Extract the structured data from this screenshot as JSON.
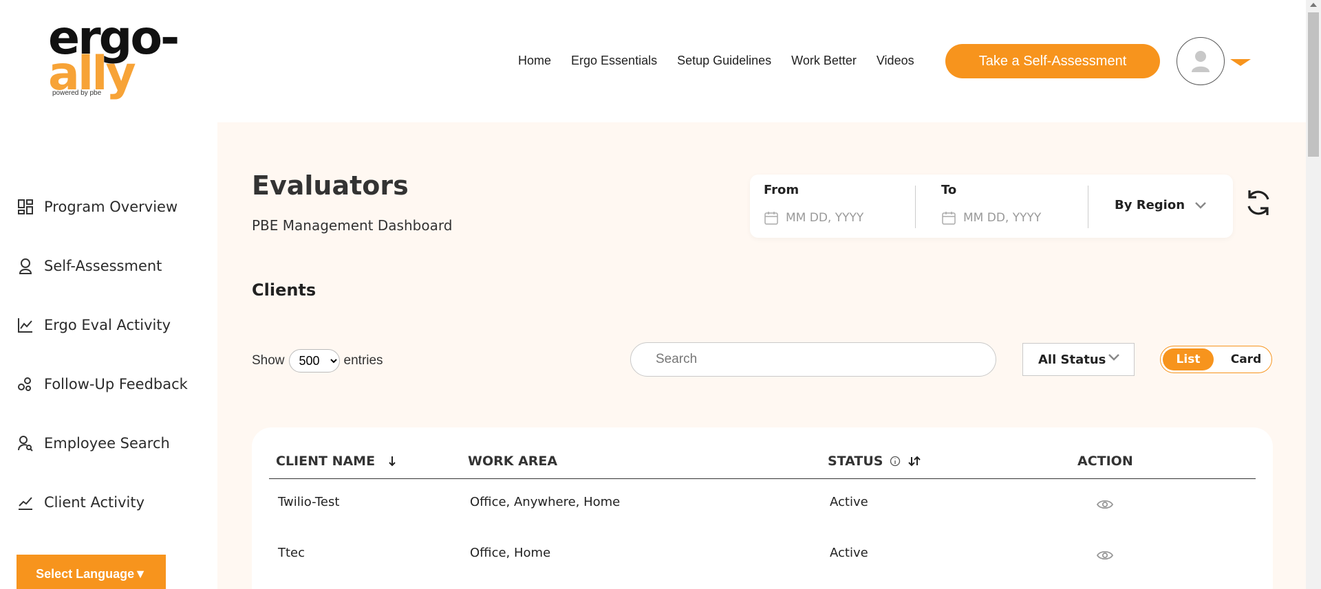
{
  "header": {
    "logo": {
      "line1": "ergo-",
      "line2": "ally",
      "tagline": "powered by pbe"
    },
    "nav": [
      "Home",
      "Ergo Essentials",
      "Setup Guidelines",
      "Work Better",
      "Videos"
    ],
    "cta_label": "Take a Self-Assessment",
    "avatar_icon": "user-icon"
  },
  "sidebar": {
    "items": [
      {
        "label": "Program Overview",
        "icon": "dashboard-icon"
      },
      {
        "label": "Self-Assessment",
        "icon": "person-icon"
      },
      {
        "label": "Ergo Eval Activity",
        "icon": "line-chart-icon"
      },
      {
        "label": "Follow-Up Feedback",
        "icon": "feedback-icon"
      },
      {
        "label": "Employee Search",
        "icon": "user-search-icon"
      },
      {
        "label": "Client Activity",
        "icon": "trend-icon"
      }
    ],
    "language_button": "Select Language▼"
  },
  "main": {
    "title": "Evaluators",
    "subtitle": "PBE Management Dashboard",
    "filters": {
      "from_label": "From",
      "from_placeholder": "MM DD, YYYY",
      "to_label": "To",
      "to_placeholder": "MM DD, YYYY",
      "region_label": "By Region"
    },
    "section_title": "Clients",
    "show_label": "Show",
    "entries_value": "500",
    "entries_label": "entries",
    "search_placeholder": "Search",
    "status_filter": "All Status",
    "view_toggle": {
      "list": "List",
      "card": "Card",
      "selected": "List"
    },
    "table": {
      "headers": [
        "CLIENT NAME",
        "WORK AREA",
        "STATUS",
        "ACTION"
      ],
      "rows": [
        {
          "client": "Twilio-Test",
          "work_area": "Office, Anywhere, Home",
          "status": "Active"
        },
        {
          "client": "Ttec",
          "work_area": "Office, Home",
          "status": "Active"
        }
      ]
    }
  },
  "colors": {
    "accent": "#f7941d",
    "page_bg": "#fff8f2",
    "logo_orange": "#f7a337"
  }
}
